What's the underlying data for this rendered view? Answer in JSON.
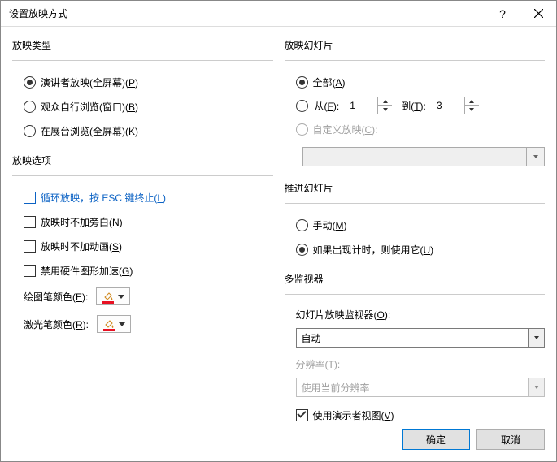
{
  "window": {
    "title": "设置放映方式"
  },
  "left": {
    "group_type": "放映类型",
    "type_presenter": "演讲者放映(全屏幕)(",
    "type_presenter_u": "P",
    "type_presenter_end": ")",
    "type_browse": "观众自行浏览(窗口)(",
    "type_browse_u": "B",
    "type_browse_end": ")",
    "type_kiosk": "在展台浏览(全屏幕)(",
    "type_kiosk_u": "K",
    "type_kiosk_end": ")",
    "group_options": "放映选项",
    "loop": "循环放映，按 ESC 键终止(",
    "loop_u": "L",
    "loop_end": ")",
    "no_narration": "放映时不加旁白(",
    "no_narration_u": "N",
    "no_narration_end": ")",
    "no_anim": "放映时不加动画(",
    "no_anim_u": "S",
    "no_anim_end": ")",
    "no_hw": "禁用硬件图形加速(",
    "no_hw_u": "G",
    "no_hw_end": ")",
    "pen_color": "绘图笔颜色(",
    "pen_color_u": "E",
    "pen_color_end": "):",
    "laser_color": "激光笔颜色(",
    "laser_color_u": "R",
    "laser_color_end": "):"
  },
  "right": {
    "group_slides": "放映幻灯片",
    "all": "全部(",
    "all_u": "A",
    "all_end": ")",
    "from": "从(",
    "from_u": "F",
    "from_end": "):",
    "from_val": "1",
    "to": "到(",
    "to_u": "T",
    "to_end": "):",
    "to_val": "3",
    "custom": "自定义放映(",
    "custom_u": "C",
    "custom_end": "):",
    "group_advance": "推进幻灯片",
    "manual": "手动(",
    "manual_u": "M",
    "manual_end": ")",
    "use_timing": "如果出现计时，则使用它(",
    "use_timing_u": "U",
    "use_timing_end": ")",
    "group_monitors": "多监视器",
    "monitor_lbl": "幻灯片放映监视器(",
    "monitor_lbl_u": "O",
    "monitor_lbl_end": "):",
    "monitor_sel": "自动",
    "res_lbl": "分辨率(",
    "res_lbl_u": "T",
    "res_lbl_end": "):",
    "res_sel": "使用当前分辨率",
    "presenter_view": "使用演示者视图(",
    "presenter_view_u": "V",
    "presenter_view_end": ")"
  },
  "buttons": {
    "ok": "确定",
    "cancel": "取消"
  }
}
